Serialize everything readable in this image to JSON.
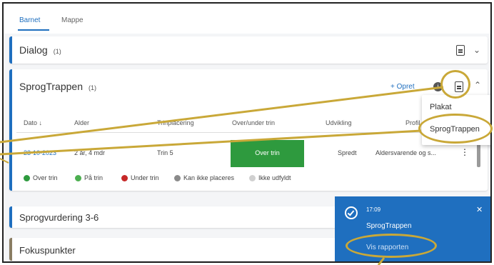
{
  "tabs": [
    {
      "label": "Barnet",
      "active": true
    },
    {
      "label": "Mappe",
      "active": false
    }
  ],
  "dialog": {
    "title": "Dialog",
    "count": "(1)"
  },
  "sprogtrappen": {
    "title": "SprogTrappen",
    "count": "(1)",
    "add_label": "+ Opret",
    "info_badge": "i",
    "columns": [
      "Dato ↓",
      "Alder",
      "Trinplacering",
      "Over/under trin",
      "Udvikling",
      "Profil"
    ],
    "row": {
      "date": "23-10-2023",
      "age": "2 år, 4 mdr",
      "step": "Trin 5",
      "over_under": "Over trin",
      "development": "Spredt",
      "profile": "Aldersvarende og s...",
      "more": "⋮"
    },
    "legend": [
      {
        "label": "Over trin",
        "color": "#2e9a3e"
      },
      {
        "label": "På trin",
        "color": "#4caf50"
      },
      {
        "label": "Under trin",
        "color": "#c62828"
      },
      {
        "label": "Kan ikke placeres",
        "color": "#8a8a8a"
      },
      {
        "label": "Ikke udfyldt",
        "color": "#d0d0d0"
      }
    ]
  },
  "sprogvurdering": {
    "title": "Sprogvurdering 3-6"
  },
  "fokuspunkter": {
    "title": "Fokuspunkter"
  },
  "menu": {
    "items": [
      "Plakat",
      "SprogTrappen"
    ]
  },
  "toast": {
    "time": "17:09",
    "title": "SprogTrappen",
    "link": "Vis rapporten",
    "close": "✕"
  },
  "colors": {
    "accent": "#1f6fbf",
    "highlight_ring": "#c9a838",
    "over_trin_cell": "#2e9a3e",
    "fokus_bar": "#8a7d63"
  }
}
